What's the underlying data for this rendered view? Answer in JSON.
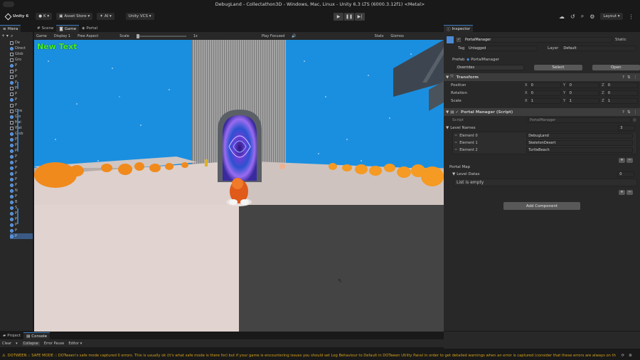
{
  "titlebar": {
    "title": "DebugLand - Collectathon3D - Windows, Mac, Linux - Unity 6.3 LTS (6000.3.12f1) <Metal>"
  },
  "toolbar": {
    "unity_label": "Unity 6",
    "account_label": "K ▾",
    "asset_store_label": "Asset Store ▾",
    "ai_label": "AI ▾",
    "vcs_label": "Unity VCS ▾",
    "layout_label": "Layout ▾"
  },
  "hierarchy": {
    "tab_label": "Hiera",
    "items": [
      "De",
      "Direct",
      "Glob",
      "Gro",
      "P",
      "P",
      "P",
      "P",
      "P",
      "P",
      "P",
      "P",
      "Dire",
      "Glo",
      "Mai",
      "Wat",
      "Glob",
      "P",
      "P",
      "P",
      "P",
      "P",
      "P",
      "P",
      "P",
      "P",
      "N",
      "P",
      "B",
      "S",
      "P",
      "P",
      "P",
      "P",
      "P"
    ]
  },
  "scene_tabs": {
    "scene": "Scene",
    "game": "Game",
    "portal": "Portal"
  },
  "game_toolbar": {
    "game_dropdown": "Game",
    "display": "Display 1",
    "aspect": "Free Aspect",
    "scale_label": "Scale",
    "scale_value": "1x",
    "play_focused": "Play Focused",
    "stats": "Stats",
    "gizmos": "Gizmos"
  },
  "game_view": {
    "overlay_text": "New Text"
  },
  "inspector": {
    "tab_label": "Inspector",
    "object_name": "PortalManager",
    "static_label": "Static",
    "tag_label": "Tag",
    "tag_value": "Untagged",
    "layer_label": "Layer",
    "layer_value": "Default",
    "prefab_label": "Prefab",
    "prefab_value": "PortalManager",
    "overrides_label": "Overrides",
    "select_label": "Select",
    "open_label": "Open",
    "transform": {
      "title": "Transform",
      "rows": [
        {
          "label": "Position",
          "x": "0",
          "y": "0",
          "z": "0"
        },
        {
          "label": "Rotation",
          "x": "0",
          "y": "0",
          "z": "0"
        },
        {
          "label": "Scale",
          "x": "1",
          "y": "1",
          "z": "1"
        }
      ]
    },
    "script_component": {
      "title": "Portal Manager (Script)",
      "script_label": "Script",
      "script_value": "PortalManager",
      "level_names_label": "Level Names",
      "level_names_count": "3",
      "elements": [
        {
          "label": "Element 0",
          "value": "DebugLand"
        },
        {
          "label": "Element 1",
          "value": "SkeletonDesert"
        },
        {
          "label": "Element 2",
          "value": "TurtleBeach"
        }
      ],
      "portal_map_label": "Portal Map",
      "level_datas_label": "Level Datas",
      "level_datas_count": "0",
      "list_empty": "List is empty"
    },
    "add_component_label": "Add Component"
  },
  "bottom": {
    "project_tab": "Project",
    "console_tab": "Console",
    "clear_label": "Clear",
    "collapse_label": "Collapse",
    "error_pause_label": "Error Pause",
    "editor_label": "Editor ▾"
  },
  "status_bar": {
    "message": "DOTWEEN :: SAFE MODE :: DOTween's safe mode captured 0 errors. This is usually ok (it's what safe mode is there for) but if your game is encountering issues you should set Log Behaviour to Default in DOTween Utility Panel in order to get detailed warnings when an error is captured (consider that these errors are always on the user"
  },
  "colors": {
    "sky": "#1a8fe0",
    "tower": "#a4a4a4",
    "floor": "#e0d3d0",
    "accent_blue": "#3a79bb",
    "orange_bush": "#f08a1c",
    "overlay_text": "#49f026"
  }
}
